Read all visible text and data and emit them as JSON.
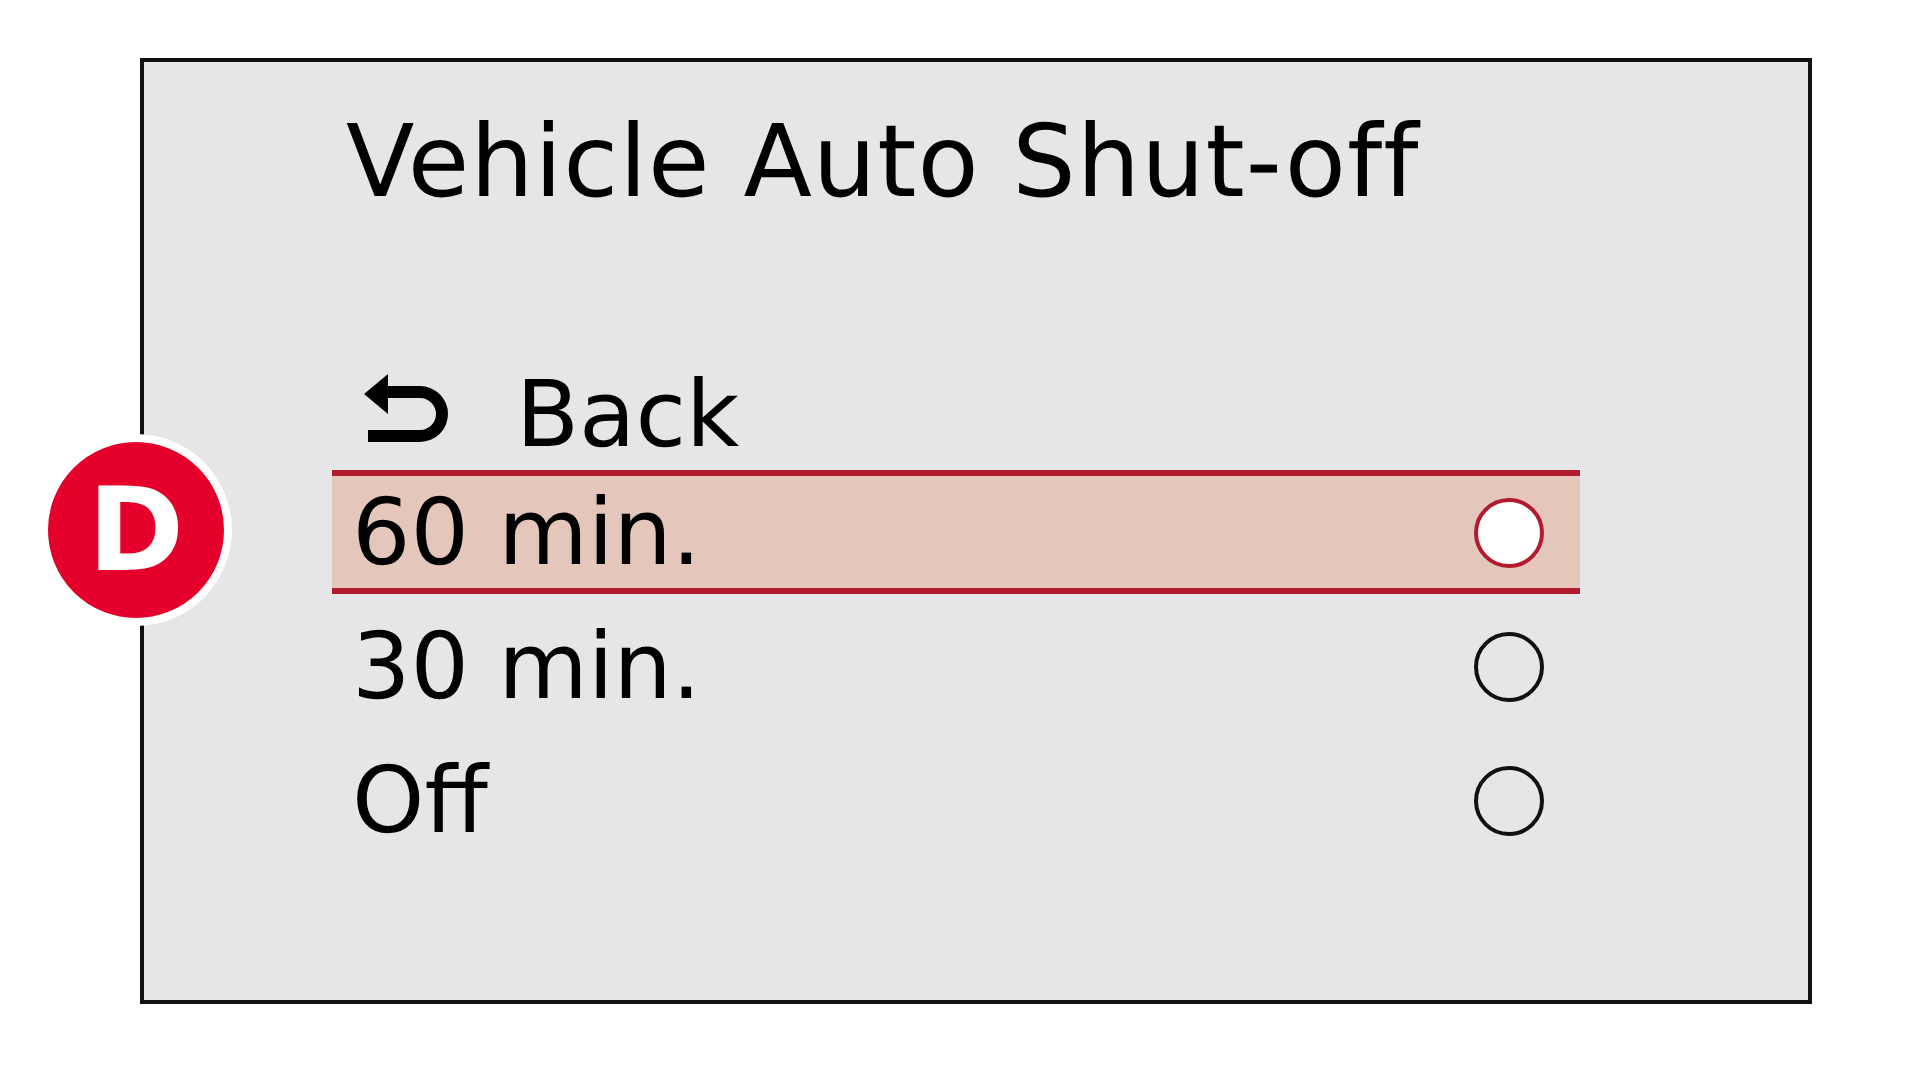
{
  "badge": "D",
  "title": "Vehicle Auto Shut-off",
  "back": {
    "label": "Back"
  },
  "options": [
    {
      "label": "60 min.",
      "selected": true
    },
    {
      "label": "30 min.",
      "selected": false
    },
    {
      "label": "Off",
      "selected": false
    }
  ]
}
